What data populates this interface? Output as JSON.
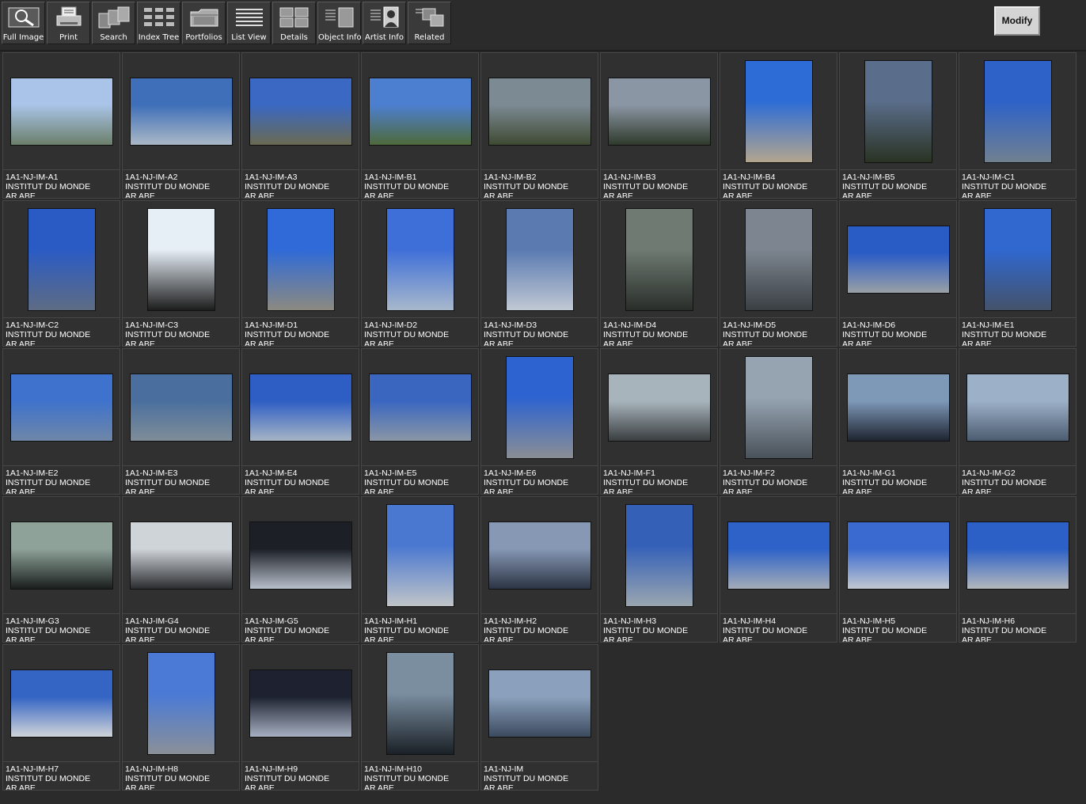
{
  "toolbar": {
    "buttons": [
      {
        "label": "Full Image",
        "icon": "magnifier-icon"
      },
      {
        "label": "Print",
        "icon": "printer-icon"
      },
      {
        "label": "Search",
        "icon": "search-cards-icon"
      },
      {
        "label": "Index Tree",
        "icon": "index-tree-icon"
      },
      {
        "label": "Portfolios",
        "icon": "folder-icon"
      },
      {
        "label": "List View",
        "icon": "list-view-icon"
      },
      {
        "label": "Details",
        "icon": "details-grid-icon"
      },
      {
        "label": "Object Info",
        "icon": "object-info-icon"
      },
      {
        "label": "Artist  Info",
        "icon": "artist-info-icon"
      },
      {
        "label": "Related",
        "icon": "related-icon"
      }
    ],
    "modify_label": "Modify"
  },
  "gallery": {
    "items": [
      {
        "id": "1A1-NJ-IM-A1",
        "title": "INSTITUT DU MONDE",
        "subtitle": "AR ABE",
        "orientation": "landscape",
        "colors": [
          "#a9c4e8",
          "#6b7f6a"
        ]
      },
      {
        "id": "1A1-NJ-IM-A2",
        "title": "INSTITUT DU MONDE",
        "subtitle": "AR ABE",
        "orientation": "landscape",
        "colors": [
          "#3f6fb8",
          "#aab8c6"
        ]
      },
      {
        "id": "1A1-NJ-IM-A3",
        "title": "INSTITUT DU MONDE",
        "subtitle": "AR ABE",
        "orientation": "landscape",
        "colors": [
          "#3a68c2",
          "#6a6a52"
        ]
      },
      {
        "id": "1A1-NJ-IM-B1",
        "title": "INSTITUT DU MONDE",
        "subtitle": "AR ABE",
        "orientation": "landscape",
        "colors": [
          "#4d7fd0",
          "#4e6a3a"
        ]
      },
      {
        "id": "1A1-NJ-IM-B2",
        "title": "INSTITUT DU MONDE",
        "subtitle": "AR ABE",
        "orientation": "landscape",
        "colors": [
          "#7c8a94",
          "#3f4a32"
        ]
      },
      {
        "id": "1A1-NJ-IM-B3",
        "title": "INSTITUT DU MONDE",
        "subtitle": "AR ABE",
        "orientation": "landscape",
        "colors": [
          "#8b96a4",
          "#2f3a2c"
        ]
      },
      {
        "id": "1A1-NJ-IM-B4",
        "title": "INSTITUT DU MONDE",
        "subtitle": "AR ABE",
        "orientation": "portrait",
        "colors": [
          "#2d6cd6",
          "#b3a58e"
        ]
      },
      {
        "id": "1A1-NJ-IM-B5",
        "title": "INSTITUT DU MONDE",
        "subtitle": "AR ABE",
        "orientation": "portrait",
        "colors": [
          "#5a6d8a",
          "#2a3324"
        ]
      },
      {
        "id": "1A1-NJ-IM-C1",
        "title": "INSTITUT DU MONDE",
        "subtitle": "AR ABE",
        "orientation": "portrait",
        "colors": [
          "#2e62c8",
          "#708090"
        ]
      },
      {
        "id": "1A1-NJ-IM-C2",
        "title": "INSTITUT DU MONDE",
        "subtitle": "AR ABE",
        "orientation": "portrait",
        "colors": [
          "#2a5bc4",
          "#5e6c84"
        ]
      },
      {
        "id": "1A1-NJ-IM-C3",
        "title": "INSTITUT DU MONDE",
        "subtitle": "AR ABE",
        "orientation": "portrait",
        "colors": [
          "#e6eef6",
          "#1c1c1c"
        ]
      },
      {
        "id": "1A1-NJ-IM-D1",
        "title": "INSTITUT DU MONDE",
        "subtitle": "AR ABE",
        "orientation": "portrait",
        "colors": [
          "#2f6ad8",
          "#8c8a80"
        ]
      },
      {
        "id": "1A1-NJ-IM-D2",
        "title": "INSTITUT DU MONDE",
        "subtitle": "AR ABE",
        "orientation": "portrait",
        "colors": [
          "#3e6fd8",
          "#a8b8cc"
        ]
      },
      {
        "id": "1A1-NJ-IM-D3",
        "title": "INSTITUT DU MONDE",
        "subtitle": "AR ABE",
        "orientation": "portrait",
        "colors": [
          "#5a7ab0",
          "#c0c8d4"
        ]
      },
      {
        "id": "1A1-NJ-IM-D4",
        "title": "INSTITUT DU MONDE",
        "subtitle": "AR ABE",
        "orientation": "portrait",
        "colors": [
          "#6e7a72",
          "#2a2e2a"
        ]
      },
      {
        "id": "1A1-NJ-IM-D5",
        "title": "INSTITUT DU MONDE",
        "subtitle": "AR ABE",
        "orientation": "portrait",
        "colors": [
          "#7d8690",
          "#3a3f44"
        ]
      },
      {
        "id": "1A1-NJ-IM-D6",
        "title": "INSTITUT DU MONDE",
        "subtitle": "AR ABE",
        "orientation": "landscape",
        "colors": [
          "#2a5cc6",
          "#9aa0a6"
        ]
      },
      {
        "id": "1A1-NJ-IM-E1",
        "title": "INSTITUT DU MONDE",
        "subtitle": "AR ABE",
        "orientation": "portrait",
        "colors": [
          "#3068d0",
          "#44526a"
        ]
      },
      {
        "id": "1A1-NJ-IM-E2",
        "title": "INSTITUT DU MONDE",
        "subtitle": "AR ABE",
        "orientation": "landscape",
        "colors": [
          "#3e72cc",
          "#6f86a8"
        ]
      },
      {
        "id": "1A1-NJ-IM-E3",
        "title": "INSTITUT DU MONDE",
        "subtitle": "AR ABE",
        "orientation": "landscape",
        "colors": [
          "#4a6f9e",
          "#7f8d98"
        ]
      },
      {
        "id": "1A1-NJ-IM-E4",
        "title": "INSTITUT DU MONDE",
        "subtitle": "AR ABE",
        "orientation": "landscape",
        "colors": [
          "#2e5ec4",
          "#a6b4c4"
        ]
      },
      {
        "id": "1A1-NJ-IM-E5",
        "title": "INSTITUT DU MONDE",
        "subtitle": "AR ABE",
        "orientation": "landscape",
        "colors": [
          "#3a66c0",
          "#8a96a6"
        ]
      },
      {
        "id": "1A1-NJ-IM-E6",
        "title": "INSTITUT DU MONDE",
        "subtitle": "AR ABE",
        "orientation": "portrait",
        "colors": [
          "#2d63d0",
          "#8a8e94"
        ]
      },
      {
        "id": "1A1-NJ-IM-F1",
        "title": "INSTITUT DU MONDE",
        "subtitle": "AR ABE",
        "orientation": "landscape",
        "colors": [
          "#a8b4bc",
          "#3a3e40"
        ]
      },
      {
        "id": "1A1-NJ-IM-F2",
        "title": "INSTITUT DU MONDE",
        "subtitle": "AR ABE",
        "orientation": "portrait",
        "colors": [
          "#96a4b2",
          "#4a525a"
        ]
      },
      {
        "id": "1A1-NJ-IM-G1",
        "title": "INSTITUT DU MONDE",
        "subtitle": "AR ABE",
        "orientation": "landscape",
        "colors": [
          "#7e98b8",
          "#1e2430"
        ]
      },
      {
        "id": "1A1-NJ-IM-G2",
        "title": "INSTITUT DU MONDE",
        "subtitle": "AR ABE",
        "orientation": "landscape",
        "colors": [
          "#9cb0c8",
          "#4c5c70"
        ]
      },
      {
        "id": "1A1-NJ-IM-G3",
        "title": "INSTITUT DU MONDE",
        "subtitle": "AR ABE",
        "orientation": "landscape",
        "colors": [
          "#8ea29a",
          "#1a1e1c"
        ]
      },
      {
        "id": "1A1-NJ-IM-G4",
        "title": "INSTITUT DU MONDE",
        "subtitle": "AR ABE",
        "orientation": "landscape",
        "colors": [
          "#cfd4d8",
          "#2a2c30"
        ]
      },
      {
        "id": "1A1-NJ-IM-G5",
        "title": "INSTITUT DU MONDE",
        "subtitle": "AR ABE",
        "orientation": "landscape",
        "colors": [
          "#1c1f26",
          "#b8c0cc"
        ]
      },
      {
        "id": "1A1-NJ-IM-H1",
        "title": "INSTITUT DU MONDE",
        "subtitle": "AR ABE",
        "orientation": "portrait",
        "colors": [
          "#4a78d0",
          "#c0c4c8"
        ]
      },
      {
        "id": "1A1-NJ-IM-H2",
        "title": "INSTITUT DU MONDE",
        "subtitle": "AR ABE",
        "orientation": "landscape",
        "colors": [
          "#8698b4",
          "#2c3444"
        ]
      },
      {
        "id": "1A1-NJ-IM-H3",
        "title": "INSTITUT DU MONDE",
        "subtitle": "AR ABE",
        "orientation": "portrait",
        "colors": [
          "#3460b8",
          "#9aa6b0"
        ]
      },
      {
        "id": "1A1-NJ-IM-H4",
        "title": "INSTITUT DU MONDE",
        "subtitle": "AR ABE",
        "orientation": "landscape",
        "colors": [
          "#2e62c8",
          "#a4acb8"
        ]
      },
      {
        "id": "1A1-NJ-IM-H5",
        "title": "INSTITUT DU MONDE",
        "subtitle": "AR ABE",
        "orientation": "landscape",
        "colors": [
          "#3a6ad0",
          "#c2c8d0"
        ]
      },
      {
        "id": "1A1-NJ-IM-H6",
        "title": "INSTITUT DU MONDE",
        "subtitle": "AR ABE",
        "orientation": "landscape",
        "colors": [
          "#2d60c6",
          "#b4b8bc"
        ]
      },
      {
        "id": "1A1-NJ-IM-H7",
        "title": "INSTITUT DU MONDE",
        "subtitle": "AR ABE",
        "orientation": "landscape",
        "colors": [
          "#3464c4",
          "#d0d4d8"
        ]
      },
      {
        "id": "1A1-NJ-IM-H8",
        "title": "INSTITUT DU MONDE",
        "subtitle": "AR ABE",
        "orientation": "portrait",
        "colors": [
          "#4a7ad6",
          "#8a9098"
        ]
      },
      {
        "id": "1A1-NJ-IM-H9",
        "title": "INSTITUT DU MONDE",
        "subtitle": "AR ABE",
        "orientation": "landscape",
        "colors": [
          "#1e2230",
          "#a6b0c2"
        ]
      },
      {
        "id": "1A1-NJ-IM-H10",
        "title": "INSTITUT DU MONDE",
        "subtitle": "AR ABE",
        "orientation": "portrait",
        "colors": [
          "#7a8ea0",
          "#1a2026"
        ]
      },
      {
        "id": "1A1-NJ-IM",
        "title": "INSTITUT DU MONDE",
        "subtitle": "AR ABE",
        "orientation": "landscape",
        "colors": [
          "#8aa0bc",
          "#3c4a5e"
        ]
      }
    ]
  }
}
